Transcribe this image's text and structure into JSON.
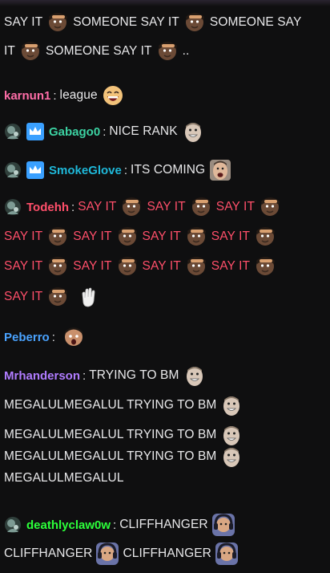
{
  "messages": [
    {
      "user": "",
      "user_color": "#e8e8ea",
      "lines": [
        [
          {
            "t": "SAY IT"
          },
          {
            "e": "saluting-man-emote"
          },
          {
            "t": "SOMEONE SAY IT"
          },
          {
            "e": "saluting-man-emote"
          },
          {
            "t": "SOMEONE SAY"
          }
        ],
        [
          {
            "t": "IT"
          },
          {
            "e": "saluting-man-emote"
          },
          {
            "t": "SOMEONE SAY IT"
          },
          {
            "e": "saluting-man-emote"
          },
          {
            "t": ".."
          }
        ]
      ]
    },
    {
      "user": "karnun1",
      "user_color": "#ff6ea8",
      "lines": [
        [
          {
            "t": "league"
          },
          {
            "e": "laughing-face-emote"
          }
        ]
      ]
    },
    {
      "user": "Gabago0",
      "user_color": "#3cd3a3",
      "badges": [
        "avatar-badge-icon",
        "crown-badge-icon"
      ],
      "lines": [
        [
          {
            "t": "NICE RANK"
          },
          {
            "e": "grinning-man-emote"
          }
        ]
      ]
    },
    {
      "user": "SmokeGlove",
      "user_color": "#1fb8d9",
      "badges": [
        "avatar-badge-icon",
        "crown-badge-icon"
      ],
      "lines": [
        [
          {
            "t": "ITS COMING"
          },
          {
            "e": "cheering-man-emote"
          }
        ]
      ]
    },
    {
      "user": "Todehh",
      "user_color": "#ff4f6a",
      "text_color": "#ff4f6a",
      "badges": [
        "avatar-badge-icon"
      ],
      "lines": [
        [
          {
            "t": "SAY IT"
          },
          {
            "e": "saluting-man-emote"
          },
          {
            "t": "SAY IT"
          },
          {
            "e": "saluting-man-emote"
          },
          {
            "t": "SAY IT"
          },
          {
            "e": "saluting-man-emote"
          }
        ],
        [
          {
            "t": "SAY IT"
          },
          {
            "e": "saluting-man-emote"
          },
          {
            "t": "SAY IT"
          },
          {
            "e": "saluting-man-emote"
          },
          {
            "t": "SAY IT"
          },
          {
            "e": "saluting-man-emote"
          },
          {
            "t": "SAY IT"
          },
          {
            "e": "saluting-man-emote"
          }
        ],
        [
          {
            "t": "SAY IT"
          },
          {
            "e": "saluting-man-emote"
          },
          {
            "t": "SAY IT"
          },
          {
            "e": "saluting-man-emote"
          },
          {
            "t": "SAY IT"
          },
          {
            "e": "saluting-man-emote"
          },
          {
            "t": "SAY IT"
          },
          {
            "e": "saluting-man-emote"
          }
        ],
        [
          {
            "t": "SAY IT"
          },
          {
            "e": "saluting-man-emote"
          },
          {
            "e": "waving-hand-emote"
          }
        ]
      ]
    },
    {
      "user": "Peberro",
      "user_color": "#4aa3ff",
      "lines": [
        [
          {
            "e": "surprised-man-emote"
          }
        ]
      ]
    },
    {
      "user": "Mrhanderson",
      "user_color": "#b07cff",
      "lines": [
        [
          {
            "t": "TRYING TO BM"
          },
          {
            "e": "grinning-man-emote"
          }
        ],
        [
          {
            "t": "MEGALULMEGALUL TRYING TO BM"
          },
          {
            "e": "grinning-man-emote"
          }
        ],
        [
          {
            "t": "MEGALULMEGALUL TRYING TO BM"
          },
          {
            "e": "grinning-man-emote"
          }
        ],
        [
          {
            "t": "MEGALULMEGALUL TRYING TO BM"
          },
          {
            "e": "grinning-man-emote"
          }
        ],
        [
          {
            "t": "MEGALULMEGALUL"
          }
        ]
      ]
    },
    {
      "user": "deathlyclaw0w",
      "user_color": "#2cff3a",
      "badges": [
        "avatar-badge-icon"
      ],
      "lines": [
        [
          {
            "t": "CLIFFHANGER"
          },
          {
            "e": "headset-man-emote"
          }
        ],
        [
          {
            "t": "CLIFFHANGER"
          },
          {
            "e": "headset-man-emote"
          },
          {
            "t": "CLIFFHANGER"
          },
          {
            "e": "headset-man-emote"
          }
        ]
      ]
    }
  ]
}
